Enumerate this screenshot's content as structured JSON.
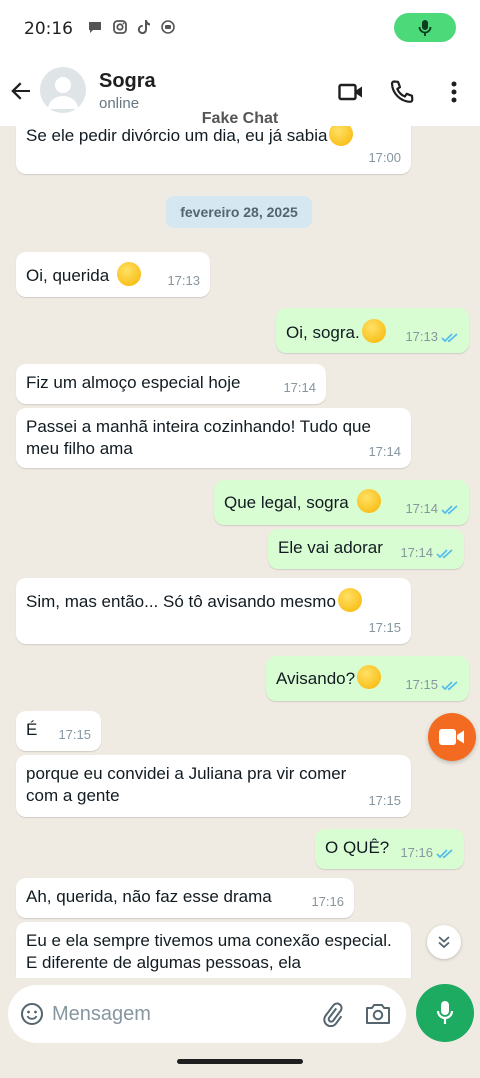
{
  "status": {
    "time": "20:16"
  },
  "header": {
    "name": "Sogra",
    "status": "online",
    "watermark": "Fake Chat"
  },
  "date_chip": "fevereiro 28, 2025",
  "messages": [
    {
      "dir": "in",
      "text": "Se ele pedir divórcio um dia, eu já sabia",
      "emoji": "smirk",
      "time": "17:00"
    },
    {
      "dir": "in",
      "text": "Oi, querida",
      "emoji": "kissing",
      "time": "17:13"
    },
    {
      "dir": "out",
      "text": "Oi, sogra.",
      "emoji": "raised-eyebrow",
      "time": "17:13"
    },
    {
      "dir": "in",
      "text": "Fiz um almoço especial hoje",
      "time": "17:14"
    },
    {
      "dir": "in",
      "text": "Passei a manhã inteira cozinhando! Tudo que meu filho ama",
      "time": "17:14"
    },
    {
      "dir": "out",
      "text": "Que legal, sogra",
      "emoji": "smiling",
      "time": "17:14"
    },
    {
      "dir": "out",
      "text": "Ele vai adorar",
      "time": "17:14"
    },
    {
      "dir": "in",
      "text": "Sim, mas então... Só tô avisando mesmo",
      "emoji": "winking",
      "time": "17:15"
    },
    {
      "dir": "out",
      "text": "Avisando?",
      "emoji": "thinking",
      "time": "17:15"
    },
    {
      "dir": "in",
      "text": "É",
      "time": "17:15"
    },
    {
      "dir": "in",
      "text": "porque eu convidei a Juliana pra vir comer com a gente",
      "time": "17:15"
    },
    {
      "dir": "out",
      "text": "O QUÊ?",
      "time": "17:16"
    },
    {
      "dir": "in",
      "text": "Ah, querida, não faz esse drama",
      "time": "17:16"
    },
    {
      "dir": "in",
      "text": "Eu e ela sempre tivemos uma conexão especial. E diferente de algumas pessoas, ela",
      "time": ""
    }
  ],
  "input": {
    "placeholder": "Mensagem"
  },
  "colors": {
    "incoming": "#ffffff",
    "outgoing": "#d9fdd3",
    "accent": "#1daa61",
    "read_tick": "#53bdeb"
  }
}
